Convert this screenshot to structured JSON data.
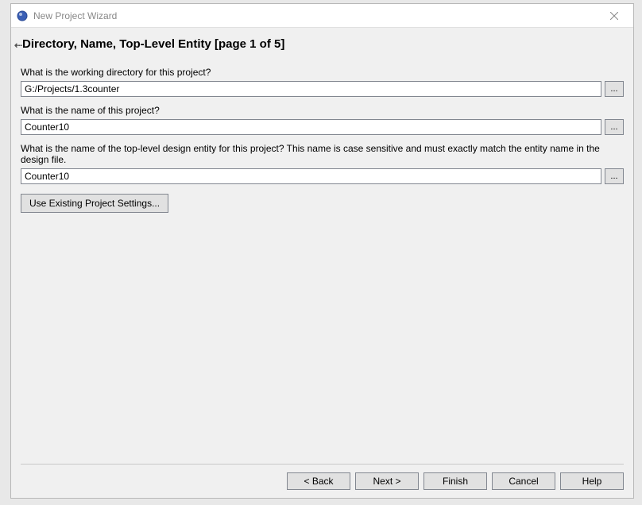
{
  "titlebar": {
    "title": "New Project Wizard"
  },
  "heading": "Directory, Name, Top-Level Entity [page 1 of 5]",
  "fields": {
    "directory": {
      "label": "What is the working directory for this project?",
      "value": "G:/Projects/1.3counter",
      "browse": "..."
    },
    "projectName": {
      "label": "What is the name of this project?",
      "value": "Counter10",
      "browse": "..."
    },
    "entityName": {
      "label": "What is the name of the top-level design entity for this project? This name is case sensitive and must exactly match the entity name in the design file.",
      "value": "Counter10",
      "browse": "..."
    }
  },
  "existingBtn": "Use Existing Project Settings...",
  "footer": {
    "back": "< Back",
    "next": "Next >",
    "finish": "Finish",
    "cancel": "Cancel",
    "help": "Help"
  }
}
